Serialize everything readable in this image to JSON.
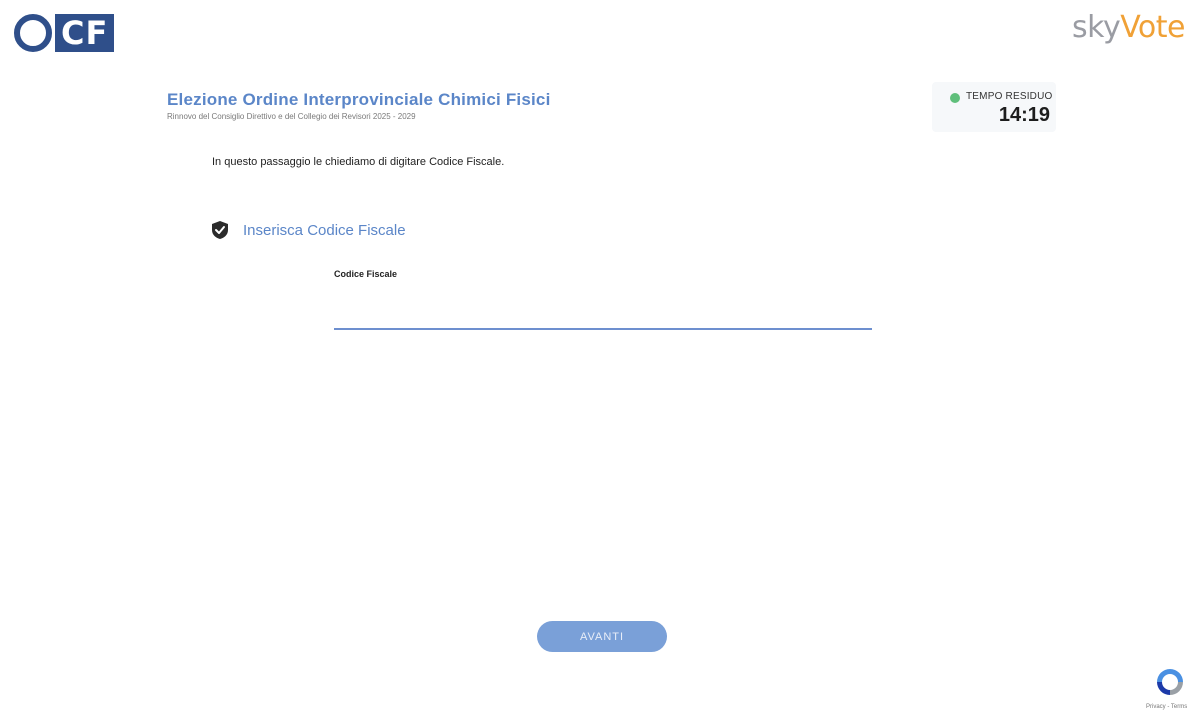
{
  "brand": {
    "ocf_o": "O",
    "ocf_cf": "CF",
    "skyvote_sky": "sky",
    "skyvote_vote": "Vote"
  },
  "header": {
    "title": "Elezione Ordine Interprovinciale Chimici Fisici",
    "subtitle": "Rinnovo del Consiglio Direttivo e del Collegio dei Revisori 2025 - 2029"
  },
  "timer": {
    "label": "TEMPO RESIDUO",
    "value": "14:19",
    "status_color": "#5fbf7b"
  },
  "step": {
    "instruction": "In questo passaggio le chiediamo di digitare Codice Fiscale.",
    "section_title": "Inserisca Codice Fiscale",
    "section_icon": "shield-check-icon",
    "field_label": "Codice Fiscale",
    "field_value": "",
    "next_label": "AVANTI"
  },
  "recaptcha": {
    "icon": "recaptcha-icon",
    "text": "Privacy - Terms"
  },
  "colors": {
    "accent": "#5b86c8",
    "button": "#7aa0d8",
    "brand_blue": "#2f4f8a",
    "brand_orange": "#f0a136"
  }
}
